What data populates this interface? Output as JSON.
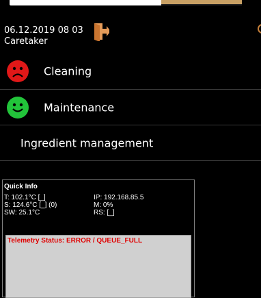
{
  "header": {
    "datetime": "06.12.2019 08 03",
    "user": "Caretaker"
  },
  "icons": {
    "logout": "logout-door-arrow-icon",
    "cleaning_status": "sad-face-icon",
    "maintenance_status": "happy-face-icon"
  },
  "menu": {
    "items": [
      {
        "label": "Cleaning",
        "status": "red"
      },
      {
        "label": "Maintenance",
        "status": "green"
      },
      {
        "label": "Ingredient management"
      }
    ]
  },
  "quick_info": {
    "title": "Quick Info",
    "t": "T: 102.1°C [_]",
    "s": "S: 124.6°C [_] (0)",
    "sw": "SW: 25.1°C",
    "ip": "IP: 192.168.85.5",
    "m": "M: 0%",
    "rs": "RS: [_]",
    "telemetry_status": "Telemetry Status: ERROR / QUEUE_FULL"
  },
  "colors": {
    "background": "#000000",
    "status_red": "#e01818",
    "status_green": "#22c43a",
    "icon_orange": "#e59b59",
    "telemetry_text": "#e00000"
  }
}
